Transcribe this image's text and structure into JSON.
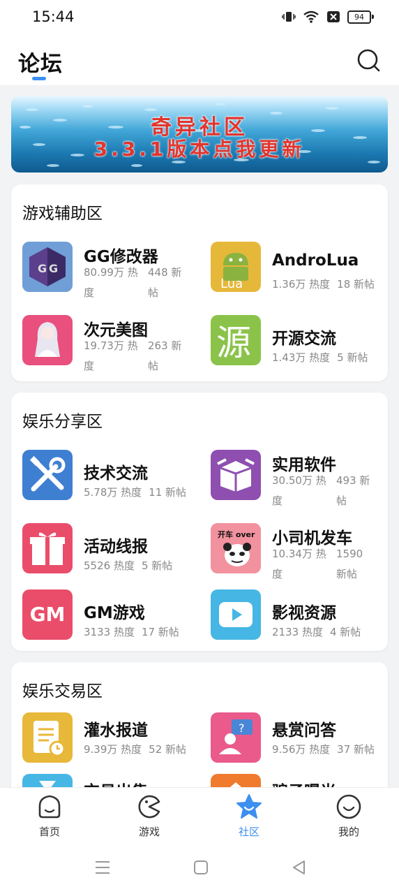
{
  "status": {
    "time": "15:44",
    "battery": "94"
  },
  "header": {
    "title": "论坛"
  },
  "banner": {
    "line1": "奇异社区",
    "line2": "3.3.1版本点我更新"
  },
  "sections": [
    {
      "title": "游戏辅助区",
      "items": [
        {
          "name": "GG修改器",
          "heat": "80.99万 热度",
          "posts": "448 新帖",
          "icon": "gg-modifier-icon"
        },
        {
          "name": "AndroLua",
          "heat": "1.36万 热度",
          "posts": "18 新帖",
          "icon": "androlua-icon"
        },
        {
          "name": "次元美图",
          "heat": "19.73万 热度",
          "posts": "263 新帖",
          "icon": "anime-art-icon"
        },
        {
          "name": "开源交流",
          "heat": "1.43万 热度",
          "posts": "5 新帖",
          "icon": "open-source-icon"
        }
      ]
    },
    {
      "title": "娱乐分享区",
      "items": [
        {
          "name": "技术交流",
          "heat": "5.78万 热度",
          "posts": "11 新帖",
          "icon": "tools-icon"
        },
        {
          "name": "实用软件",
          "heat": "30.50万 热度",
          "posts": "493 新帖",
          "icon": "box-icon"
        },
        {
          "name": "活动线报",
          "heat": "5526 热度",
          "posts": "5 新帖",
          "icon": "gift-icon"
        },
        {
          "name": "小司机发车",
          "heat": "10.34万 热度",
          "posts": "1590 新帖",
          "icon": "panda-meme-icon",
          "icon_text": "开车 over"
        },
        {
          "name": "GM游戏",
          "heat": "3133 热度",
          "posts": "17 新帖",
          "icon": "gm-icon",
          "icon_text": "GM"
        },
        {
          "name": "影视资源",
          "heat": "2133 热度",
          "posts": "4 新帖",
          "icon": "play-icon"
        }
      ]
    },
    {
      "title": "娱乐交易区",
      "items": [
        {
          "name": "灌水报道",
          "heat": "9.39万 热度",
          "posts": "52 新帖",
          "icon": "note-clock-icon"
        },
        {
          "name": "悬赏问答",
          "heat": "9.56万 热度",
          "posts": "37 新帖",
          "icon": "question-user-icon"
        },
        {
          "name": "交易出售",
          "icon": "hourglass-icon"
        },
        {
          "name": "骗子曝光",
          "icon": "house-icon"
        }
      ]
    }
  ],
  "tabs": [
    {
      "label": "首页",
      "icon": "home-icon"
    },
    {
      "label": "游戏",
      "icon": "game-icon"
    },
    {
      "label": "社区",
      "icon": "community-star-icon",
      "active": true
    },
    {
      "label": "我的",
      "icon": "profile-smile-icon"
    }
  ],
  "colors": {
    "accent": "#3d8ff0",
    "background": "#f2f3f5"
  }
}
